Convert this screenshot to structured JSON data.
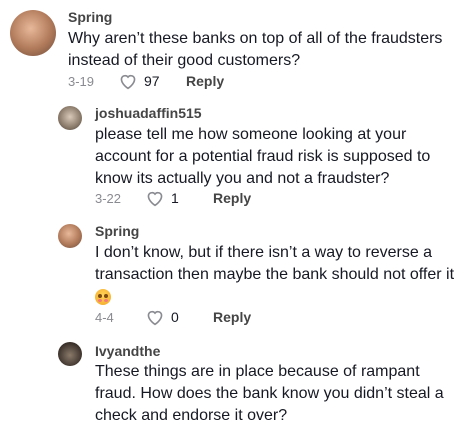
{
  "comments": [
    {
      "username": "Spring",
      "text": "Why aren’t these banks on top of all of the fraudsters instead of their good customers?",
      "date": "3-19",
      "likes": "97",
      "reply_label": "Reply",
      "avatar_icon": "user-avatar"
    },
    {
      "username": "joshuadaffin515",
      "text": "please tell me how someone looking at your account for a potential fraud risk is supposed to know its actually you and not a fraudster?",
      "date": "3-22",
      "likes": "1",
      "reply_label": "Reply",
      "avatar_icon": "user-avatar"
    },
    {
      "username": "Spring",
      "text": "I don’t know, but if there isn’t a way to reverse a transaction then maybe the bank should not offer it",
      "emoji": "flushed-face-emoji",
      "date": "4-4",
      "likes": "0",
      "reply_label": "Reply",
      "avatar_icon": "user-avatar"
    },
    {
      "username": "Ivyandthe",
      "text": "These things are in place because of rampant fraud. How does the bank know you didn’t steal a check and endorse it over?",
      "avatar_icon": "user-avatar"
    }
  ]
}
